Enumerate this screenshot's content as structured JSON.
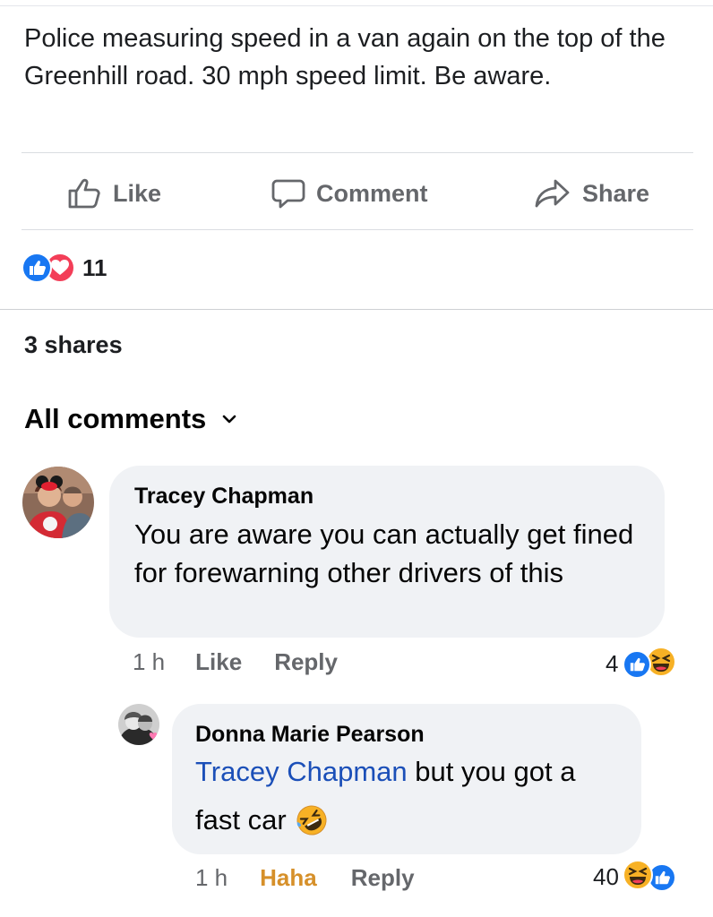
{
  "post": {
    "text": "Police measuring speed in a van again on the top of the Greenhill road. 30 mph speed limit. Be aware."
  },
  "actions": {
    "like": "Like",
    "comment": "Comment",
    "share": "Share"
  },
  "reactions": {
    "count": "11",
    "types": [
      "like-icon",
      "love-icon"
    ]
  },
  "shares_label": "3 shares",
  "comments_filter": "All comments",
  "colors": {
    "like_blue": "#1877f2",
    "love_red": "#f33e58",
    "haha_yellow": "#f7b125",
    "haha_orange": "#d6902a",
    "mention_blue": "#1b4fb8"
  },
  "comments": [
    {
      "author": "Tracey Chapman",
      "text": "You are aware you can actually get fined for forewarning other drivers of this",
      "time": "1 h",
      "like_label": "Like",
      "reply_label": "Reply",
      "reaction_count": "4",
      "reaction_types": [
        "like-icon",
        "haha-icon"
      ]
    },
    {
      "author": "Donna Marie Pearson",
      "mention": "Tracey Chapman",
      "text_after_mention": " but you got a",
      "text_line2": "fast car",
      "emoji": "rolling-laughing-icon",
      "time": "1 h",
      "like_label": "Haha",
      "reply_label": "Reply",
      "reaction_count": "40",
      "reaction_types": [
        "haha-icon",
        "like-icon"
      ]
    }
  ]
}
